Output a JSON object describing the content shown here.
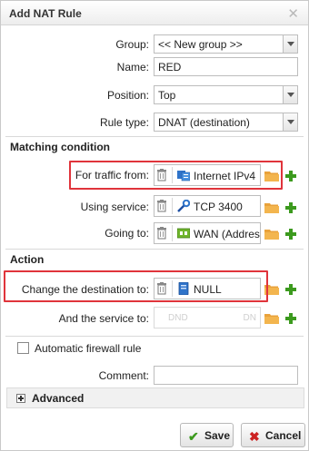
{
  "dialog": {
    "title": "Add NAT Rule",
    "close_glyph": "✕"
  },
  "form": {
    "group": {
      "label": "Group:",
      "value": "<< New group >>"
    },
    "name": {
      "label": "Name:",
      "value": "RED"
    },
    "position": {
      "label": "Position:",
      "value": "Top"
    },
    "rule_type": {
      "label": "Rule type:",
      "value": "DNAT (destination)"
    }
  },
  "matching": {
    "heading": "Matching condition",
    "traffic_from": {
      "label": "For traffic from:",
      "value": "Internet IPv4",
      "icon": "network-icon"
    },
    "using_service": {
      "label": "Using service:",
      "value": "TCP 3400",
      "icon": "service-icon"
    },
    "going_to": {
      "label": "Going to:",
      "value": "WAN (Address)",
      "icon": "interface-icon"
    }
  },
  "action": {
    "heading": "Action",
    "change_destination": {
      "label": "Change the destination to:",
      "value": "NULL",
      "icon": "host-icon"
    },
    "and_service": {
      "label": "And the service to:",
      "placeholder_left": "DND",
      "placeholder_right": "DN"
    }
  },
  "auto_firewall": {
    "label": "Automatic firewall rule",
    "checked": false
  },
  "comment": {
    "label": "Comment:",
    "value": ""
  },
  "advanced": {
    "label": "Advanced"
  },
  "buttons": {
    "save": "Save",
    "cancel": "Cancel"
  },
  "colors": {
    "highlight": "#e0343b",
    "plus": "#3c9a1e",
    "folder": "#e9a23b",
    "cancel_icon": "#cc2222",
    "save_icon": "#3c9a1e"
  }
}
